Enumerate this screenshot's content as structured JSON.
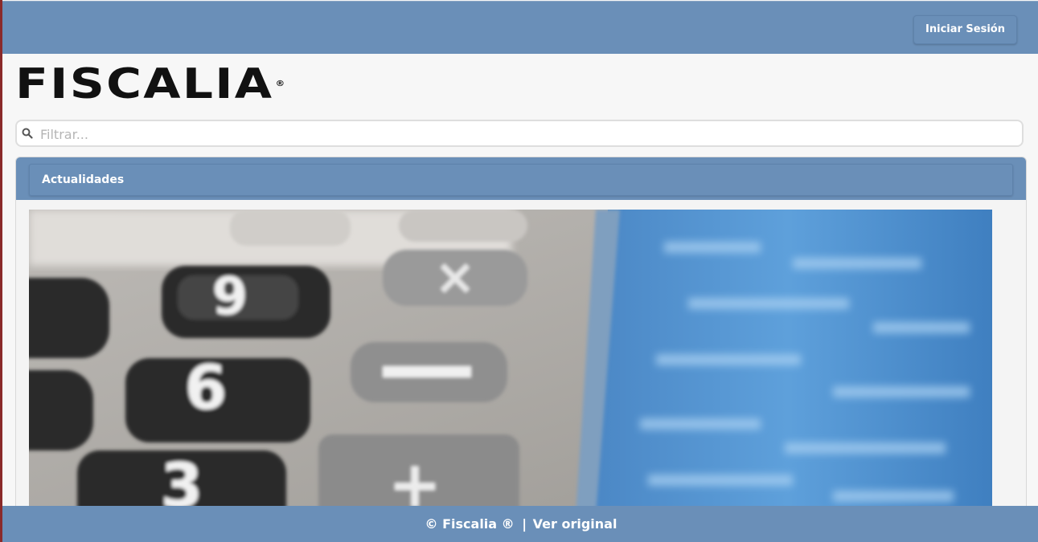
{
  "header": {
    "login_label": "Iniciar Sesión"
  },
  "brand": {
    "logo_text": "FISCALIA",
    "registered": "®"
  },
  "search": {
    "placeholder": "Filtrar...",
    "icon": "search-icon"
  },
  "panel": {
    "title": "Actualidades",
    "image_subject": "calculator keypad beside a blue spreadsheet"
  },
  "footer": {
    "copyright": "© Fiscalia ®",
    "separator": "|",
    "link_label": "Ver original"
  },
  "colors": {
    "bar_blue": "#6a8fb8",
    "page_bg": "#f7f7f7"
  }
}
